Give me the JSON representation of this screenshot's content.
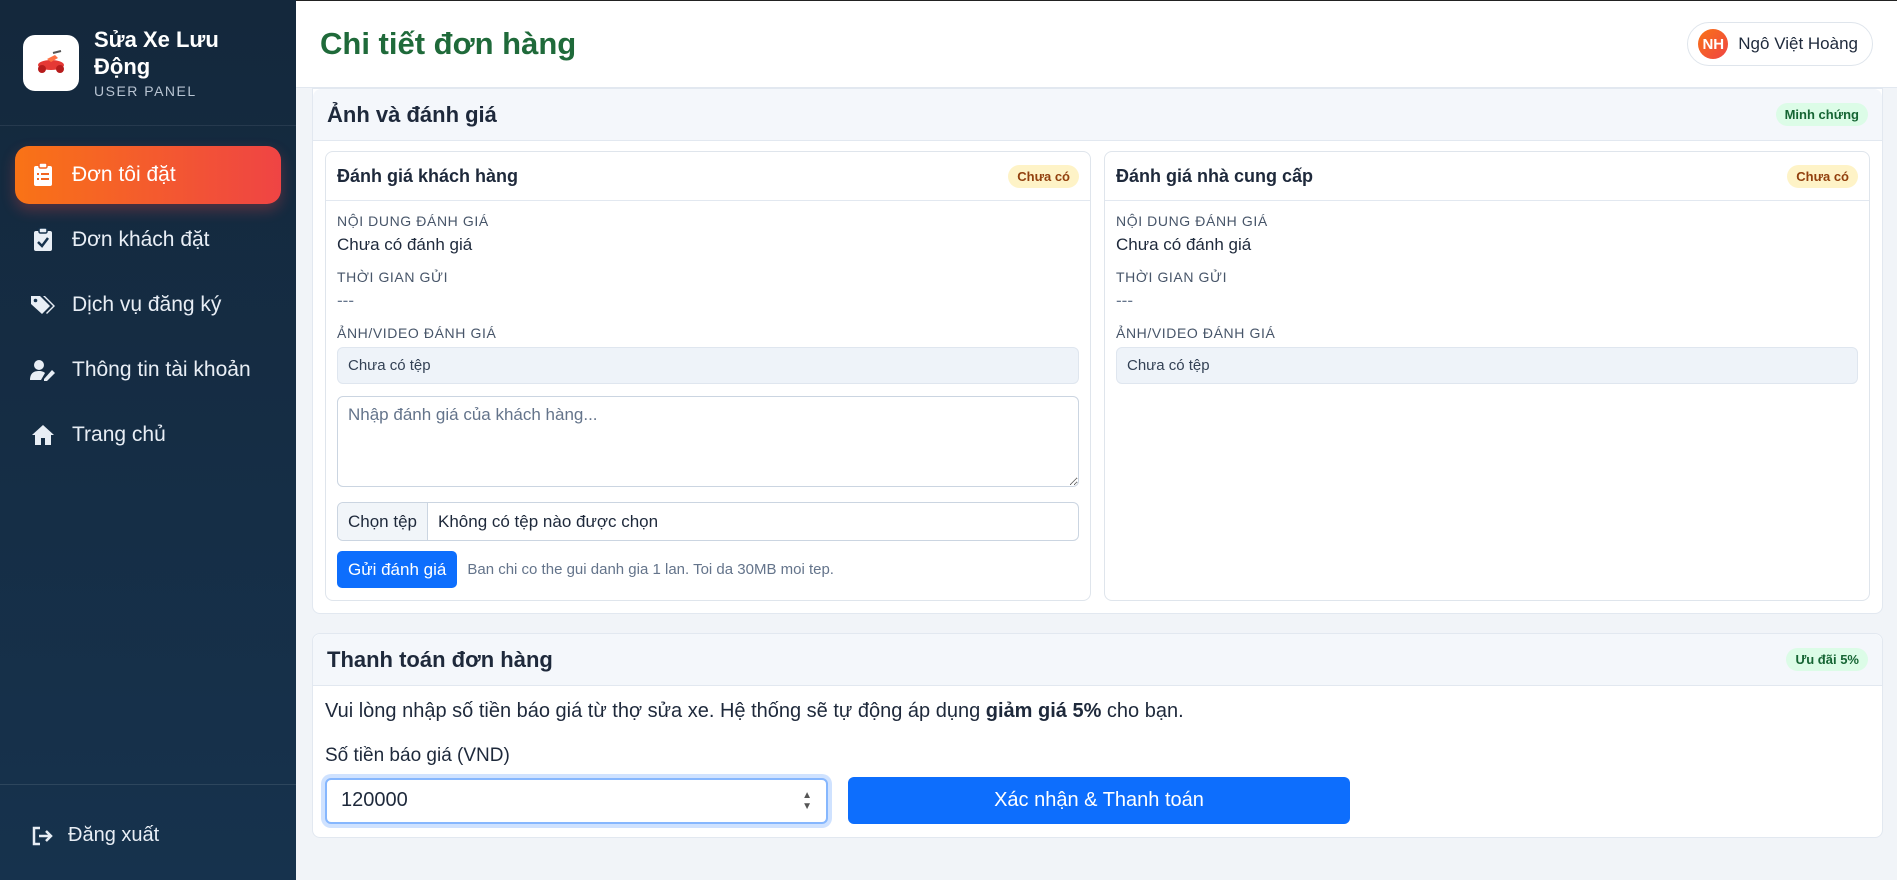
{
  "brand": {
    "title": "Sửa Xe Lưu Động",
    "subtitle": "USER PANEL",
    "logo_icon": "scooter-logo-icon"
  },
  "sidebar": {
    "items": [
      {
        "label": "Đơn tôi đặt",
        "icon": "clipboard-list-icon",
        "active": true
      },
      {
        "label": "Đơn khách đặt",
        "icon": "clipboard-check-icon",
        "active": false
      },
      {
        "label": "Dịch vụ đăng ký",
        "icon": "tags-icon",
        "active": false
      },
      {
        "label": "Thông tin tài khoản",
        "icon": "user-edit-icon",
        "active": false
      },
      {
        "label": "Trang chủ",
        "icon": "home-icon",
        "active": false
      }
    ],
    "logout_label": "Đăng xuất"
  },
  "header": {
    "title": "Chi tiết đơn hàng",
    "user_initials": "NH",
    "user_name": "Ngô Việt Hoàng"
  },
  "reviews": {
    "title": "Ảnh và đánh giá",
    "badge": "Minh chứng",
    "customer": {
      "title": "Đánh giá khách hàng",
      "badge": "Chưa có",
      "content_label": "NỘI DUNG ĐÁNH GIÁ",
      "content_value": "Chưa có đánh giá",
      "time_label": "THỜI GIAN GỬI",
      "time_value": "---",
      "media_label": "ẢNH/VIDEO ĐÁNH GIÁ",
      "media_value": "Chưa có tệp",
      "textarea_placeholder": "Nhập đánh giá của khách hàng...",
      "file_button": "Chọn tệp",
      "file_name": "Không có tệp nào được chọn",
      "submit_label": "Gửi đánh giá",
      "hint": "Ban chi co the gui danh gia 1 lan. Toi da 30MB moi tep."
    },
    "provider": {
      "title": "Đánh giá nhà cung cấp",
      "badge": "Chưa có",
      "content_label": "NỘI DUNG ĐÁNH GIÁ",
      "content_value": "Chưa có đánh giá",
      "time_label": "THỜI GIAN GỬI",
      "time_value": "---",
      "media_label": "ẢNH/VIDEO ĐÁNH GIÁ",
      "media_value": "Chưa có tệp"
    }
  },
  "payment": {
    "title": "Thanh toán đơn hàng",
    "badge": "Ưu đãi 5%",
    "desc_before": "Vui lòng nhập số tiền báo giá từ thợ sửa xe. Hệ thống sẽ tự động áp dụng ",
    "desc_bold": "giảm giá 5%",
    "desc_after": " cho bạn.",
    "amount_label": "Số tiền báo giá (VND)",
    "amount_value": "120000",
    "confirm_label": "Xác nhận & Thanh toán"
  },
  "colors": {
    "sidebar_bg": "#14283c",
    "active_gradient_start": "#f97316",
    "active_gradient_end": "#ef4444",
    "title_green": "#1f6a3a",
    "primary": "#0d6efd"
  }
}
